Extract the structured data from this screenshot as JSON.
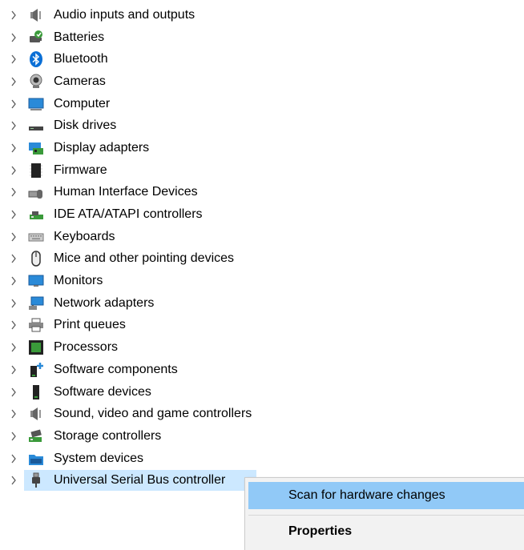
{
  "devices": [
    {
      "label": "Audio inputs and outputs",
      "icon": "speaker-icon"
    },
    {
      "label": "Batteries",
      "icon": "battery-icon"
    },
    {
      "label": "Bluetooth",
      "icon": "bluetooth-icon"
    },
    {
      "label": "Cameras",
      "icon": "camera-icon"
    },
    {
      "label": "Computer",
      "icon": "computer-icon"
    },
    {
      "label": "Disk drives",
      "icon": "disk-drive-icon"
    },
    {
      "label": "Display adapters",
      "icon": "display-adapter-icon"
    },
    {
      "label": "Firmware",
      "icon": "firmware-chip-icon"
    },
    {
      "label": "Human Interface Devices",
      "icon": "hid-icon"
    },
    {
      "label": "IDE ATA/ATAPI controllers",
      "icon": "ide-controller-icon"
    },
    {
      "label": "Keyboards",
      "icon": "keyboard-icon"
    },
    {
      "label": "Mice and other pointing devices",
      "icon": "mouse-icon"
    },
    {
      "label": "Monitors",
      "icon": "monitor-icon"
    },
    {
      "label": "Network adapters",
      "icon": "network-adapter-icon"
    },
    {
      "label": "Print queues",
      "icon": "printer-icon"
    },
    {
      "label": "Processors",
      "icon": "processor-icon"
    },
    {
      "label": "Software components",
      "icon": "software-component-icon"
    },
    {
      "label": "Software devices",
      "icon": "software-device-icon"
    },
    {
      "label": "Sound, video and game controllers",
      "icon": "sound-icon"
    },
    {
      "label": "Storage controllers",
      "icon": "storage-controller-icon"
    },
    {
      "label": "System devices",
      "icon": "system-devices-icon"
    },
    {
      "label": "Universal Serial Bus controller",
      "icon": "usb-icon",
      "selected": true
    }
  ],
  "context_menu": {
    "scan_label": "Scan for hardware changes",
    "properties_label": "Properties"
  },
  "colors": {
    "selection": "#cce8ff",
    "menu_hover": "#91c9f7",
    "menu_bg": "#f2f2f2",
    "chevron": "#5a5a5a"
  }
}
